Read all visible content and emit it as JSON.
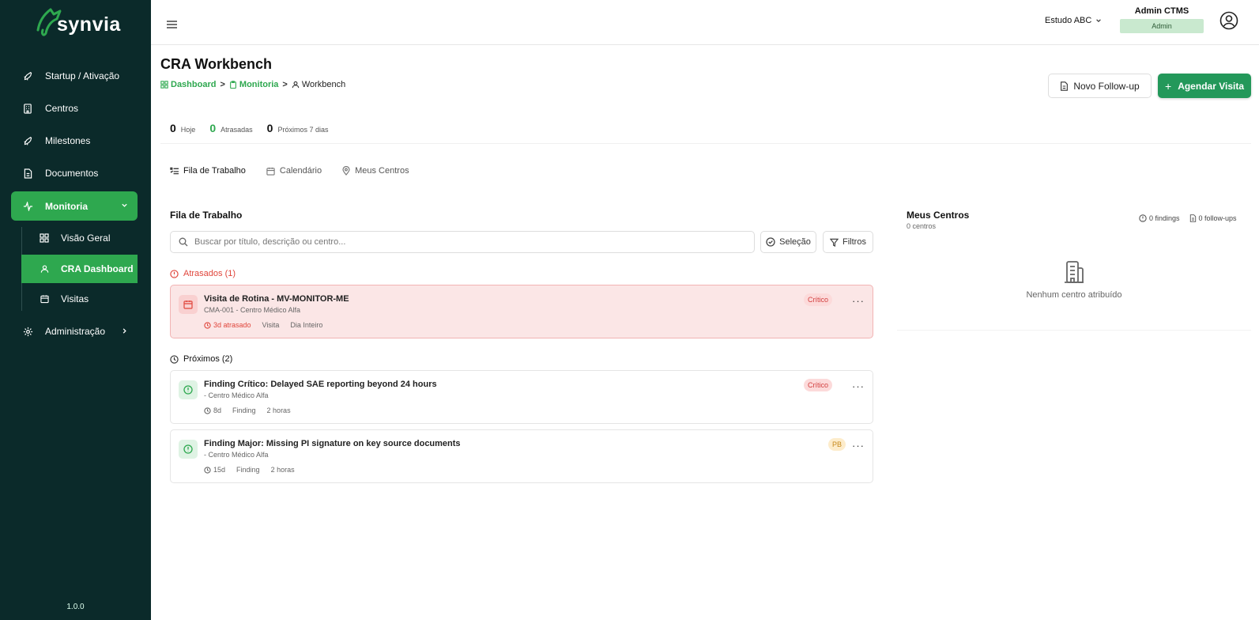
{
  "app": {
    "logo_text": "synvia",
    "version": "1.0.0"
  },
  "sidebar": {
    "items": [
      {
        "label": "Startup / Ativação",
        "icon": "rocket-icon"
      },
      {
        "label": "Centros",
        "icon": "building-icon"
      },
      {
        "label": "Milestones",
        "icon": "rocket-icon"
      },
      {
        "label": "Documentos",
        "icon": "document-icon"
      },
      {
        "label": "Monitoria",
        "icon": "activity-icon"
      },
      {
        "label": "Administração",
        "icon": "gear-icon"
      }
    ],
    "subitems": [
      {
        "label": "Visão Geral",
        "icon": "grid-icon"
      },
      {
        "label": "CRA Dashboard",
        "icon": "user-icon"
      },
      {
        "label": "Visitas",
        "icon": "calendar-icon"
      }
    ]
  },
  "header": {
    "study": "Estudo ABC",
    "user_name": "Admin CTMS",
    "user_role": "Admin"
  },
  "page": {
    "title": "CRA Workbench",
    "breadcrumb": [
      "Dashboard",
      "Monitoria",
      "Workbench"
    ],
    "btn_followup": "Novo Follow-up",
    "btn_schedule": "Agendar Visita"
  },
  "stats": [
    {
      "value": "0",
      "label": "Hoje"
    },
    {
      "value": "0",
      "label": "Atrasadas"
    },
    {
      "value": "0",
      "label": "Próximos 7 dias"
    }
  ],
  "tabs": [
    {
      "label": "Fila de Trabalho",
      "active": true
    },
    {
      "label": "Calendário",
      "active": false
    },
    {
      "label": "Meus Centros",
      "active": false
    }
  ],
  "queue": {
    "title": "Fila de Trabalho",
    "search_placeholder": "Buscar por título, descrição ou centro...",
    "btn_selection": "Seleção",
    "btn_filters": "Filtros",
    "overdue_title": "Atrasados (1)",
    "upcoming_title": "Próximos (2)",
    "overdue": [
      {
        "title": "Visita de Rotina - MV-MONITOR-ME",
        "subtitle": "CMA-001 - Centro Médico Alfa",
        "due": "3d atrasado",
        "kind": "Visita",
        "duration": "Dia Inteiro",
        "badge": "Crítico"
      }
    ],
    "upcoming": [
      {
        "title": "Finding Crítico: Delayed SAE reporting beyond 24 hours",
        "subtitle": "- Centro Médico Alfa",
        "due": "8d",
        "kind": "Finding",
        "duration": "2 horas",
        "badge": "Crítico"
      },
      {
        "title": "Finding Major: Missing PI signature on key source documents",
        "subtitle": "- Centro Médico Alfa",
        "due": "15d",
        "kind": "Finding",
        "duration": "2 horas",
        "badge": "PB"
      }
    ]
  },
  "centers": {
    "title": "Meus Centros",
    "count": "0 centros",
    "findings": "0 findings",
    "followups": "0 follow-ups",
    "empty": "Nenhum centro atribuído"
  },
  "colors": {
    "brand_green": "#2ea84f",
    "sidebar_bg": "#0b2a2a",
    "danger": "#e0453b"
  }
}
